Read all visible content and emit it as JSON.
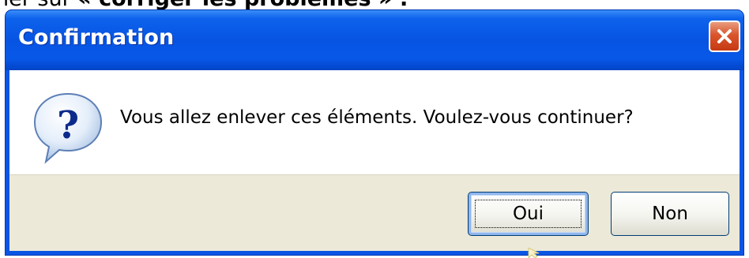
{
  "page_heading": {
    "prefix": "ner sur ",
    "emphasis": "« corriger les problèmes » :"
  },
  "dialog": {
    "title": "Confirmation",
    "message": "Vous allez enlever ces éléments. Voulez-vous continuer?",
    "icon": "question-icon",
    "buttons": {
      "yes_label": "Oui",
      "no_label": "Non"
    },
    "default_button": "Oui"
  },
  "theme": {
    "titlebar_blue": "#0754e2",
    "close_red": "#d9552c",
    "dialog_face": "#ece9d8",
    "focus_blue": "#8fb6ec"
  }
}
